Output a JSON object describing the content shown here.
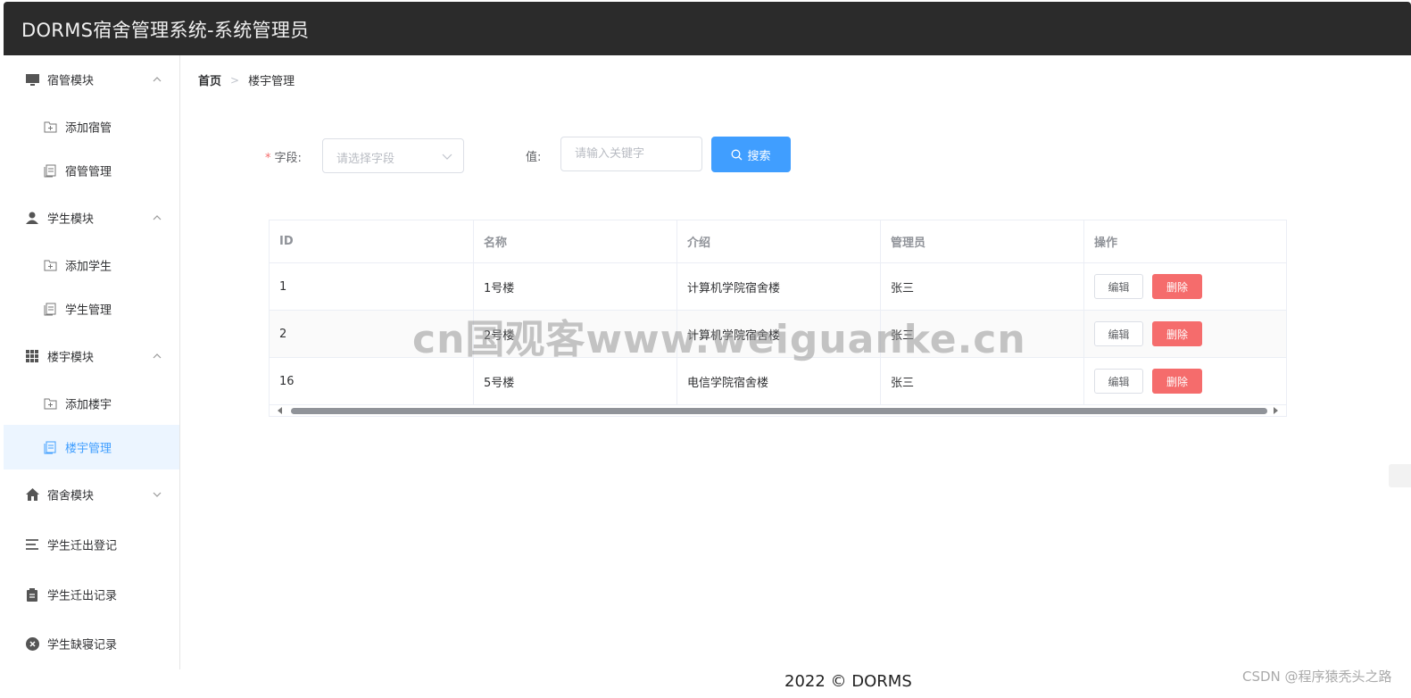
{
  "app": {
    "title": "DORMS宿舍管理系统-系统管理员"
  },
  "sidebar": {
    "items": [
      {
        "label": "宿管模块",
        "icon": "monitor-icon",
        "expanded": true
      },
      {
        "label": "添加宿管",
        "icon": "folder-add-icon"
      },
      {
        "label": "宿管管理",
        "icon": "document-copy-icon"
      },
      {
        "label": "学生模块",
        "icon": "user-icon",
        "expanded": true
      },
      {
        "label": "添加学生",
        "icon": "folder-add-icon"
      },
      {
        "label": "学生管理",
        "icon": "document-copy-icon"
      },
      {
        "label": "楼宇模块",
        "icon": "grid-icon",
        "expanded": true
      },
      {
        "label": "添加楼宇",
        "icon": "folder-add-icon"
      },
      {
        "label": "楼宇管理",
        "icon": "document-copy-icon",
        "active": true
      },
      {
        "label": "宿舍模块",
        "icon": "house-icon",
        "expanded": false
      },
      {
        "label": "学生迁出登记",
        "icon": "list-icon"
      },
      {
        "label": "学生迁出记录",
        "icon": "clipboard-icon"
      },
      {
        "label": "学生缺寝记录",
        "icon": "circle-close-icon"
      }
    ]
  },
  "breadcrumb": {
    "home": "首页",
    "separator": ">",
    "current": "楼宇管理"
  },
  "search": {
    "field_label": "字段:",
    "field_placeholder": "请选择字段",
    "value_label": "值:",
    "value_placeholder": "请输入关键字",
    "button_label": "搜索"
  },
  "table": {
    "headers": [
      "ID",
      "名称",
      "介绍",
      "管理员",
      "操作"
    ],
    "rows": [
      {
        "id": "1",
        "name": "1号楼",
        "intro": "计算机学院宿舍楼",
        "admin": "张三"
      },
      {
        "id": "2",
        "name": "2号楼",
        "intro": "计算机学院宿舍楼",
        "admin": "张三"
      },
      {
        "id": "16",
        "name": "5号楼",
        "intro": "电信学院宿舍楼",
        "admin": "张三"
      }
    ],
    "edit_label": "编辑",
    "delete_label": "删除"
  },
  "footer": {
    "text": "2022 © DORMS"
  },
  "overlay": {
    "watermark": "cn国观客www.weiguanke.cn",
    "csdn": "CSDN @程序猿秃头之路"
  },
  "colors": {
    "topbar": "#2b2b2b",
    "accent": "#409eff",
    "danger": "#f56c6c",
    "active_bg": "#ecf5ff"
  }
}
